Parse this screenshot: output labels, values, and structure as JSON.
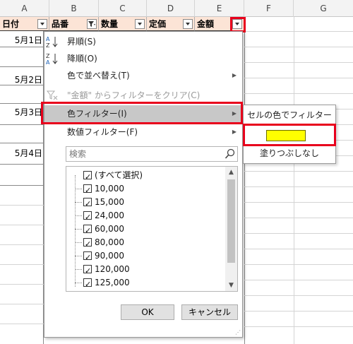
{
  "columns": [
    "A",
    "B",
    "C",
    "D",
    "E",
    "F",
    "G"
  ],
  "headers": [
    {
      "label": "日付",
      "filter": "dropdown"
    },
    {
      "label": "品番",
      "filter": "filtered"
    },
    {
      "label": "数量",
      "filter": "dropdown"
    },
    {
      "label": "定価",
      "filter": "dropdown"
    },
    {
      "label": "金額",
      "filter": "dropdown"
    }
  ],
  "dates": [
    "5月1日",
    "5月2日",
    "5月3日",
    "5月4日"
  ],
  "menu": {
    "sort_asc": "昇順(S)",
    "sort_desc": "降順(O)",
    "sort_color": "色で並べ替え(T)",
    "clear_filter": "\"金額\" からフィルターをクリア(C)",
    "color_filter": "色フィルター(I)",
    "number_filter": "数値フィルター(F)",
    "search_placeholder": "検索",
    "list_items": [
      "(すべて選択)",
      "10,000",
      "15,000",
      "24,000",
      "60,000",
      "80,000",
      "90,000",
      "120,000",
      "125,000"
    ],
    "ok_label": "OK",
    "cancel_label": "キャンセル"
  },
  "submenu": {
    "title": "セルの色でフィルター",
    "swatch_color": "#ffff00",
    "no_fill": "塗りつぶしなし"
  },
  "highlight_color": "#e8001c"
}
